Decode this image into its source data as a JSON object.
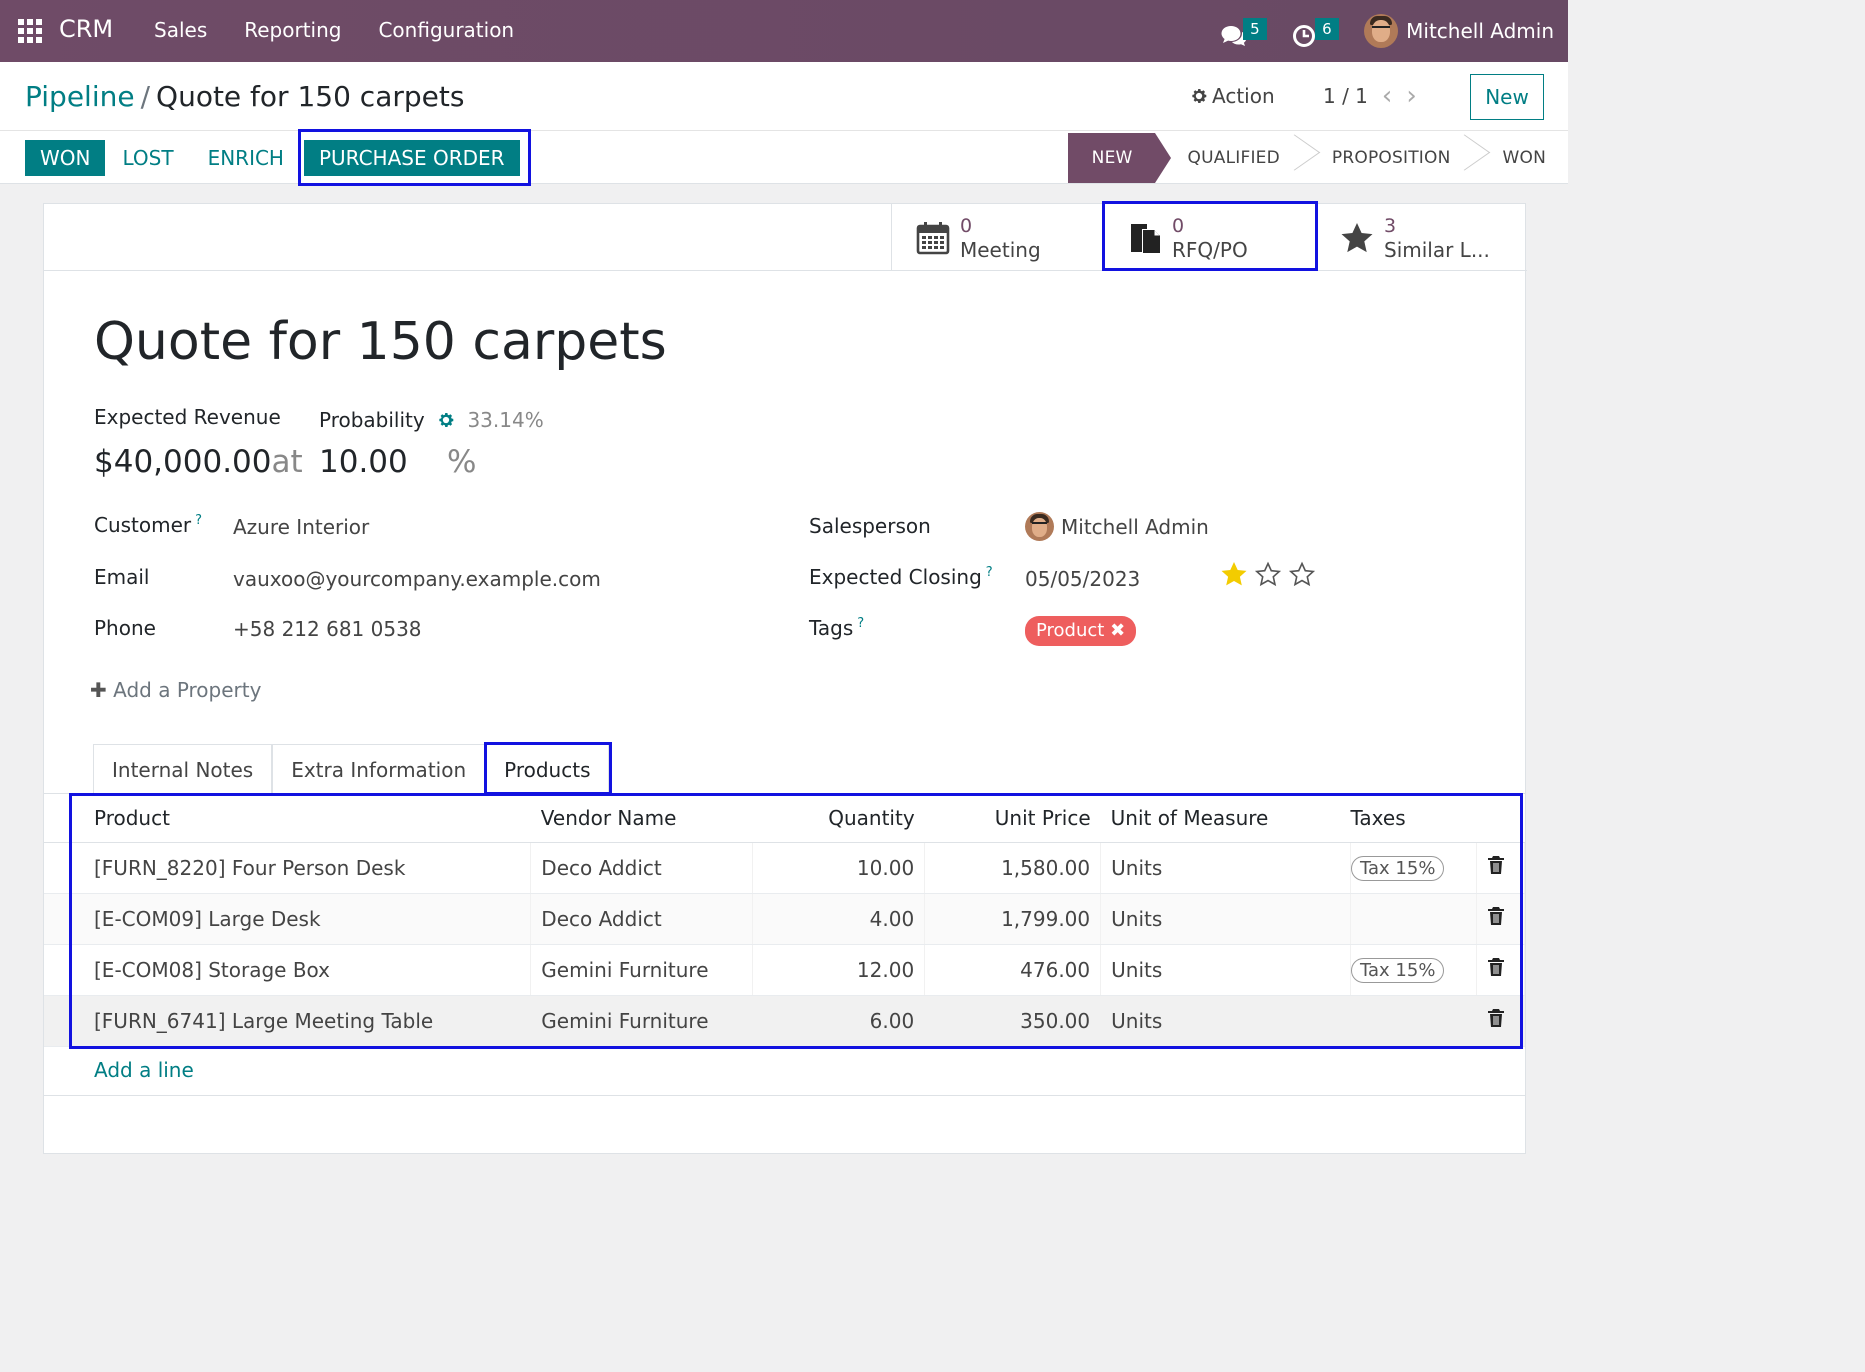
{
  "navbar": {
    "brand": "CRM",
    "menu": [
      "Sales",
      "Reporting",
      "Configuration"
    ],
    "messages_count": "5",
    "activities_count": "6",
    "user": "Mitchell Admin",
    "color": "#714b67"
  },
  "control": {
    "breadcrumb_parent": "Pipeline",
    "breadcrumb_sep": "/",
    "breadcrumb_current": "Quote for 150 carpets",
    "action_label": "Action",
    "pager": "1 / 1",
    "new_label": "New"
  },
  "buttons": {
    "won": "WON",
    "lost": "LOST",
    "enrich": "ENRICH",
    "purchase_order": "PURCHASE ORDER"
  },
  "stages": [
    "NEW",
    "QUALIFIED",
    "PROPOSITION",
    "WON"
  ],
  "smart_buttons": [
    {
      "value": "0",
      "label": "Meeting",
      "icon": "calendar-icon"
    },
    {
      "value": "0",
      "label": "RFQ/PO",
      "icon": "document-icon"
    },
    {
      "value": "3",
      "label": "Similar L...",
      "icon": "star-icon"
    }
  ],
  "form": {
    "title": "Quote for 150 carpets",
    "expected_revenue_label": "Expected Revenue",
    "expected_revenue": "$40,000.00",
    "at_label": "at",
    "probability_label": "Probability",
    "auto_probability": "33.14%",
    "probability": "10.00",
    "percent": "%",
    "customer_label": "Customer",
    "customer": "Azure Interior",
    "email_label": "Email",
    "email": "vauxoo@yourcompany.example.com",
    "phone_label": "Phone",
    "phone": "+58 212 681 0538",
    "salesperson_label": "Salesperson",
    "salesperson": "Mitchell Admin",
    "closing_label": "Expected Closing",
    "closing": "05/05/2023",
    "priority_stars": 1,
    "priority_max": 3,
    "tags_label": "Tags",
    "tag": "Product",
    "tag_color": "#ee5e5e",
    "help_mark": "?",
    "add_property": "Add a Property"
  },
  "tabs": [
    "Internal Notes",
    "Extra Information",
    "Products"
  ],
  "products": {
    "columns": [
      "Product",
      "Vendor Name",
      "Quantity",
      "Unit Price",
      "Unit of Measure",
      "Taxes"
    ],
    "rows": [
      {
        "product": "[FURN_8220] Four Person Desk",
        "vendor": "Deco Addict",
        "qty": "10.00",
        "price": "1,580.00",
        "uom": "Units",
        "tax": "Tax 15%"
      },
      {
        "product": "[E-COM09] Large Desk",
        "vendor": "Deco Addict",
        "qty": "4.00",
        "price": "1,799.00",
        "uom": "Units",
        "tax": ""
      },
      {
        "product": "[E-COM08] Storage Box",
        "vendor": "Gemini Furniture",
        "qty": "12.00",
        "price": "476.00",
        "uom": "Units",
        "tax": "Tax 15%"
      },
      {
        "product": "[FURN_6741] Large Meeting Table",
        "vendor": "Gemini Furniture",
        "qty": "6.00",
        "price": "350.00",
        "uom": "Units",
        "tax": ""
      }
    ],
    "add_line": "Add a line"
  }
}
